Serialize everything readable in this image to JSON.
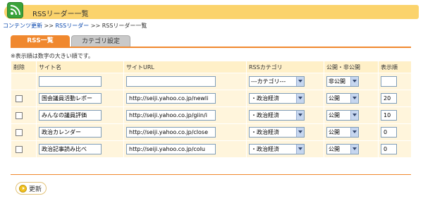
{
  "page": {
    "title": "RSSリーダー一覧"
  },
  "breadcrumb": {
    "item1": "コンテンツ更新",
    "sep": " >> ",
    "item2": "RSSリーダー",
    "item3": "RSSリーダー一覧"
  },
  "tabs": [
    {
      "label": "RSS一覧"
    },
    {
      "label": "カテゴリ設定"
    }
  ],
  "note": "※表示順は数字の大きい順です。",
  "table": {
    "headers": {
      "delete": "削除",
      "site_name": "サイト名",
      "site_url": "サイトURL",
      "category": "RSSカテゴリ",
      "public": "公開・非公開",
      "order": "表示順"
    },
    "new_row": {
      "site_name": "",
      "site_url": "",
      "category": "---カテゴリ---",
      "public": "非公開",
      "order": ""
    },
    "rows": [
      {
        "site_name": "国会議員活動レポー",
        "site_url": "http://seiji.yahoo.co.jp/newli",
        "category": "・政治経済",
        "public": "公開",
        "order": "20"
      },
      {
        "site_name": "みんなの議員評価",
        "site_url": "http://seiji.yahoo.co.jp/giin/i",
        "category": "・政治経済",
        "public": "公開",
        "order": "10"
      },
      {
        "site_name": "政治カレンダー",
        "site_url": "http://seiji.yahoo.co.jp/close",
        "category": "・政治経済",
        "public": "公開",
        "order": "0"
      },
      {
        "site_name": "政治記事読み比べ",
        "site_url": "http://seiji.yahoo.co.jp/colu",
        "category": "・政治経済",
        "public": "公開",
        "order": "0"
      }
    ]
  },
  "update_button": {
    "label": "更新"
  },
  "icons": {
    "app": "rss-icon",
    "update": "play-arrow-icon",
    "dropdown": "chevron-down-icon"
  },
  "colors": {
    "title_bar": "#fbd36c",
    "accent": "#f0882e",
    "link": "#0645ad",
    "header_bg": "#fff0c8",
    "cell_bg": "#fff5dc"
  }
}
